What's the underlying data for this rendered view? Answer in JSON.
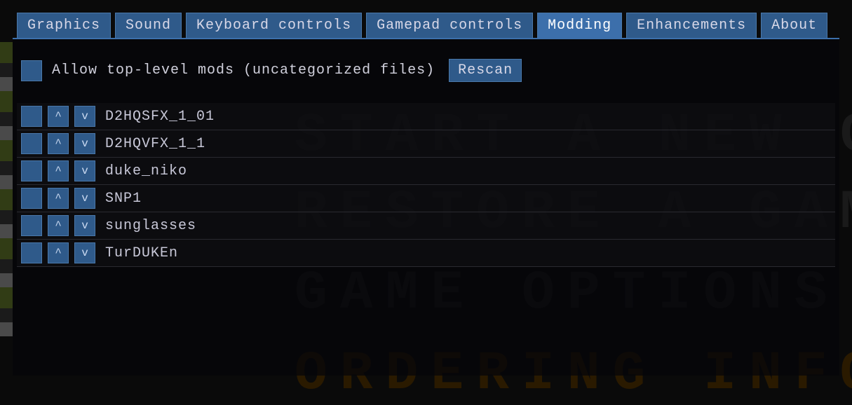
{
  "tabs": [
    {
      "label": "Graphics",
      "active": false
    },
    {
      "label": "Sound",
      "active": false
    },
    {
      "label": "Keyboard controls",
      "active": false
    },
    {
      "label": "Gamepad controls",
      "active": false
    },
    {
      "label": "Modding",
      "active": true
    },
    {
      "label": "Enhancements",
      "active": false
    },
    {
      "label": "About",
      "active": false
    }
  ],
  "options": {
    "allow_top_level_label": "Allow top-level mods (uncategorized files)",
    "rescan_label": "Rescan"
  },
  "controls": {
    "up_glyph": "^",
    "down_glyph": "v"
  },
  "mods": [
    {
      "name": "D2HQSFX_1_01"
    },
    {
      "name": "D2HQVFX_1_1"
    },
    {
      "name": "duke_niko"
    },
    {
      "name": "SNP1"
    },
    {
      "name": "sunglasses"
    },
    {
      "name": "TurDUKEn"
    }
  ],
  "background_menu": [
    "Start A New Game",
    "Restore A Game",
    "Game Options",
    "Ordering Informat"
  ]
}
